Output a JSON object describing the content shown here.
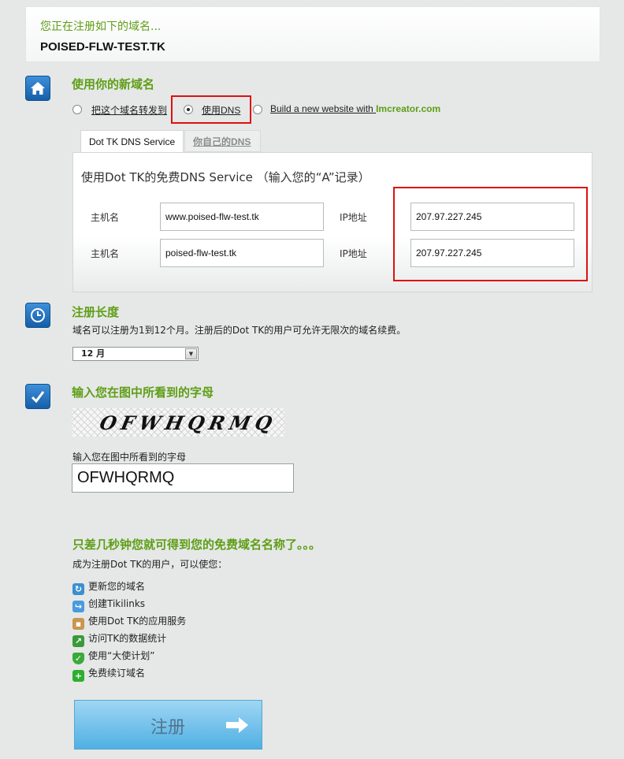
{
  "header": {
    "subtitle": "您正在注册如下的域名...",
    "domain": "POISED-FLW-TEST.TK"
  },
  "use_domain": {
    "title": "使用你的新域名",
    "options": [
      {
        "label": "把这个域名转发到",
        "selected": false
      },
      {
        "label": "使用DNS",
        "selected": true
      },
      {
        "label": "Build a new website with",
        "link": "Imcreator.com",
        "selected": false
      }
    ],
    "tabs": [
      "Dot TK DNS Service",
      "你自己的DNS"
    ],
    "dns_title": "使用Dot TK的免费DNS Service （输入您的“A”记录）",
    "records": [
      {
        "host_label": "主机名",
        "host": "www.poised-flw-test.tk",
        "ip_label": "IP地址",
        "ip": "207.97.227.245"
      },
      {
        "host_label": "主机名",
        "host": "poised-flw-test.tk",
        "ip_label": "IP地址",
        "ip": "207.97.227.245"
      }
    ]
  },
  "registration_length": {
    "title": "注册长度",
    "description": "域名可以注册为1到12个月。注册后的Dot TK的用户可允许无限次的域名续费。",
    "selected": "12 月"
  },
  "captcha": {
    "title": "输入您在图中所看到的字母",
    "image_text": "OFWHQRMQ",
    "input_label": "输入您在图中所看到的字母",
    "input_value": "OFWHQRMQ"
  },
  "promo": {
    "title": "只差几秒钟您就可得到您的免费域名名称了。。。",
    "subtitle": "成为注册Dot TK的用户，可以使您：",
    "features": [
      {
        "icon": "refresh-icon",
        "label": "更新您的域名"
      },
      {
        "icon": "link-icon",
        "label": "创建Tikilinks"
      },
      {
        "icon": "package-icon",
        "label": "使用Dot TK的应用服务"
      },
      {
        "icon": "chart-icon",
        "label": "访问TK的数据统计"
      },
      {
        "icon": "shield-icon",
        "label": "使用“大使计划”"
      },
      {
        "icon": "plus-icon",
        "label": "免费续订域名"
      }
    ]
  },
  "register_button": "注册",
  "colors": {
    "accent_green": "#5f9e16",
    "highlight_red": "#dd1111",
    "button_blue": "#4fb0e3"
  }
}
